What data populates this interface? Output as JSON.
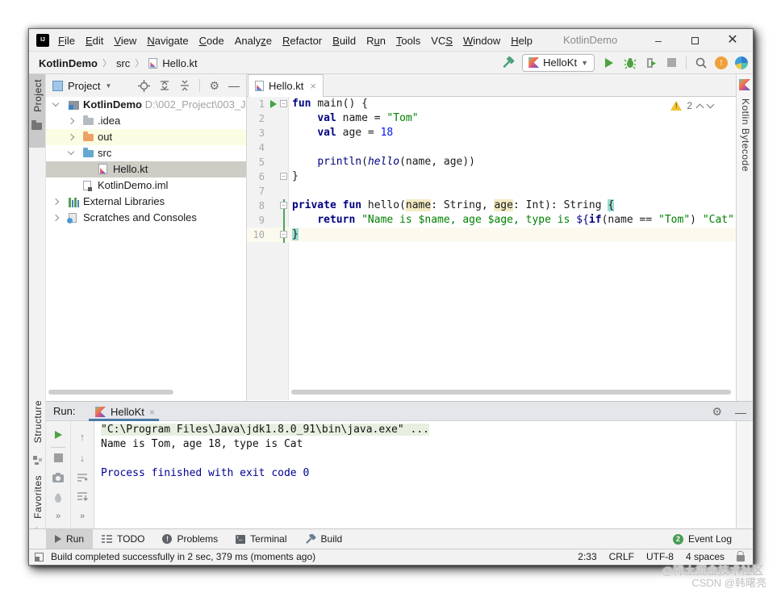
{
  "titlebar": {
    "title": "KotlinDemo",
    "menus": [
      {
        "pre": "",
        "u": "F",
        "post": "ile"
      },
      {
        "pre": "",
        "u": "E",
        "post": "dit"
      },
      {
        "pre": "",
        "u": "V",
        "post": "iew"
      },
      {
        "pre": "",
        "u": "N",
        "post": "avigate"
      },
      {
        "pre": "",
        "u": "C",
        "post": "ode"
      },
      {
        "pre": "Analy",
        "u": "z",
        "post": "e"
      },
      {
        "pre": "",
        "u": "R",
        "post": "efactor"
      },
      {
        "pre": "",
        "u": "B",
        "post": "uild"
      },
      {
        "pre": "R",
        "u": "u",
        "post": "n"
      },
      {
        "pre": "",
        "u": "T",
        "post": "ools"
      },
      {
        "pre": "VC",
        "u": "S",
        "post": ""
      },
      {
        "pre": "",
        "u": "W",
        "post": "indow"
      },
      {
        "pre": "",
        "u": "H",
        "post": "elp"
      }
    ]
  },
  "toolbar": {
    "breadcrumbs": [
      "KotlinDemo",
      "src",
      "Hello.kt"
    ],
    "run_config": "HelloKt"
  },
  "project_panel": {
    "header": "Project",
    "tree": [
      {
        "label": "KotlinDemo",
        "extra": " D:\\002_Project\\003_J...",
        "level": 0,
        "chevron": "d",
        "icon": "project",
        "bold": true
      },
      {
        "label": ".idea",
        "level": 1,
        "chevron": "r",
        "icon": "folder"
      },
      {
        "label": "out",
        "level": 1,
        "chevron": "r",
        "icon": "folder-orange",
        "highlight": true
      },
      {
        "label": "src",
        "level": 1,
        "chevron": "d",
        "icon": "folder-blue"
      },
      {
        "label": "Hello.kt",
        "level": 2,
        "chevron": "",
        "icon": "kotlin",
        "selected": true
      },
      {
        "label": "KotlinDemo.iml",
        "level": 1,
        "chevron": "",
        "icon": "iml"
      },
      {
        "label": "External Libraries",
        "level": 0,
        "chevron": "r",
        "icon": "libs"
      },
      {
        "label": "Scratches and Consoles",
        "level": 0,
        "chevron": "r",
        "icon": "scratch"
      }
    ]
  },
  "left_stripe": {
    "top": "Project",
    "bottom1": "Structure",
    "bottom2": "Favorites"
  },
  "right_stripe": {
    "label": "Kotlin Bytecode"
  },
  "editor": {
    "tab": "Hello.kt",
    "warning_count": "2",
    "lines": [
      {
        "n": "1",
        "fold": true,
        "run": true,
        "segs": [
          {
            "t": "fun ",
            "c": "kw"
          },
          {
            "t": "main",
            "c": "pl"
          },
          {
            "t": "() {",
            "c": "pl"
          }
        ]
      },
      {
        "n": "2",
        "segs": [
          {
            "t": "    ",
            "c": "pl"
          },
          {
            "t": "val ",
            "c": "kw"
          },
          {
            "t": "name = ",
            "c": "pl"
          },
          {
            "t": "\"Tom\"",
            "c": "str"
          }
        ]
      },
      {
        "n": "3",
        "segs": [
          {
            "t": "    ",
            "c": "pl"
          },
          {
            "t": "val ",
            "c": "kw"
          },
          {
            "t": "age = ",
            "c": "pl"
          },
          {
            "t": "18",
            "c": "num"
          }
        ]
      },
      {
        "n": "4",
        "segs": []
      },
      {
        "n": "5",
        "segs": [
          {
            "t": "    ",
            "c": "pl"
          },
          {
            "t": "println",
            "c": "kw2"
          },
          {
            "t": "(",
            "c": "pl"
          },
          {
            "t": "hello",
            "c": "itl"
          },
          {
            "t": "(name, age))",
            "c": "pl"
          }
        ]
      },
      {
        "n": "6",
        "fold": true,
        "segs": [
          {
            "t": "}",
            "c": "pl"
          }
        ]
      },
      {
        "n": "7",
        "segs": []
      },
      {
        "n": "8",
        "fold": true,
        "segs": [
          {
            "t": "private fun ",
            "c": "kw"
          },
          {
            "t": "hello",
            "c": "pl"
          },
          {
            "t": "(",
            "c": "pl"
          },
          {
            "t": "name",
            "c": "phl"
          },
          {
            "t": ": String, ",
            "c": "pl"
          },
          {
            "t": "age",
            "c": "phl"
          },
          {
            "t": ": Int): String ",
            "c": "pl"
          },
          {
            "t": "{",
            "c": "brace"
          }
        ]
      },
      {
        "n": "9",
        "segs": [
          {
            "t": "    ",
            "c": "pl"
          },
          {
            "t": "return ",
            "c": "kw"
          },
          {
            "t": "\"Name is ",
            "c": "str"
          },
          {
            "t": "$name",
            "c": "str"
          },
          {
            "t": ", age ",
            "c": "str"
          },
          {
            "t": "$age",
            "c": "str"
          },
          {
            "t": ", type is ",
            "c": "str"
          },
          {
            "t": "${",
            "c": "kw2"
          },
          {
            "t": "if",
            "c": "kw"
          },
          {
            "t": "(name == ",
            "c": "pl"
          },
          {
            "t": "\"Tom\"",
            "c": "str"
          },
          {
            "t": ") ",
            "c": "pl"
          },
          {
            "t": "\"Cat\"",
            "c": "str"
          }
        ]
      },
      {
        "n": "10",
        "fold": true,
        "current": true,
        "segs": [
          {
            "t": "}",
            "c": "brace"
          }
        ]
      }
    ]
  },
  "run_panel": {
    "label": "Run:",
    "tab": "HelloKt",
    "console": [
      [
        {
          "t": "\"C:\\Program Files\\Java\\jdk1.8.0_91\\bin\\java.exe\" ...",
          "c": "chl"
        }
      ],
      [
        {
          "t": "Name is Tom, age 18, type is Cat",
          "c": ""
        }
      ],
      [],
      [
        {
          "t": "Process finished with exit code 0",
          "c": "csys"
        }
      ]
    ]
  },
  "bottom_bar": {
    "items": [
      "Run",
      "TODO",
      "Problems",
      "Terminal",
      "Build"
    ],
    "event_log": "Event Log",
    "event_count": "2"
  },
  "status_bar": {
    "message": "Build completed successfully in 2 sec, 379 ms (moments ago)",
    "position": "2:33",
    "line_ending": "CRLF",
    "encoding": "UTF-8",
    "indent": "4 spaces"
  },
  "watermark": {
    "line1": "@稀土掘金技术社区",
    "line2": "CSDN @韩曙亮"
  }
}
